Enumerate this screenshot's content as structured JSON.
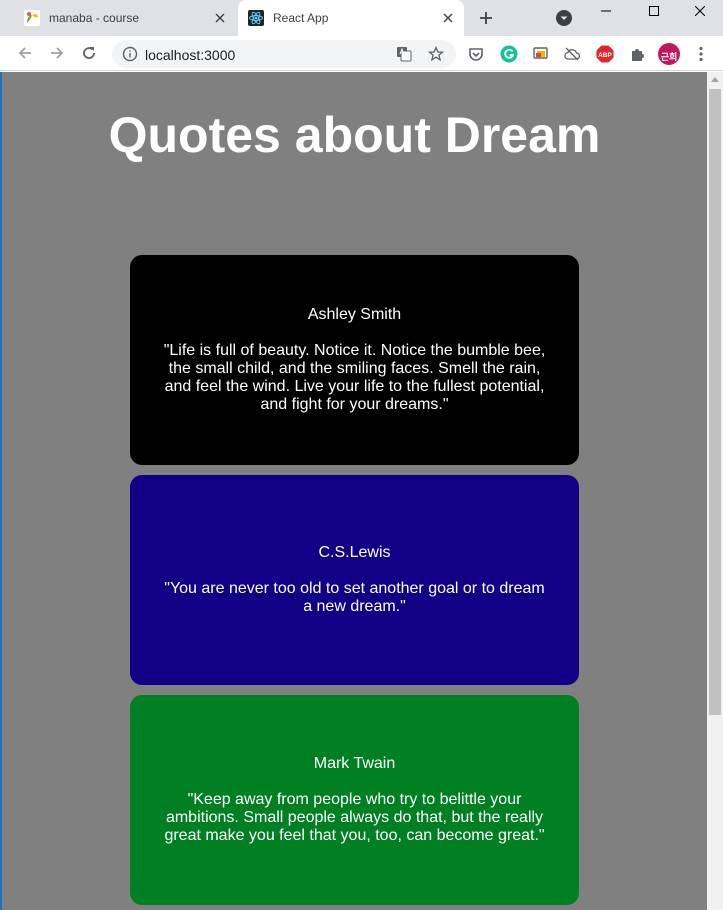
{
  "browser": {
    "tabs": [
      {
        "title": "manaba - course",
        "active": false
      },
      {
        "title": "React App",
        "active": true
      }
    ],
    "url": "localhost:3000"
  },
  "page": {
    "title": "Quotes about Dream",
    "background": "#808080",
    "quotes": [
      {
        "author": "Ashley Smith",
        "text": "\"Life is full of beauty. Notice it. Notice the bumble bee, the small child, and the smiling faces. Smell the rain, and feel the wind. Live your life to the fullest potential, and fight for your dreams.\"",
        "color": "#000000"
      },
      {
        "author": "C.S.Lewis",
        "text": "\"You are never too old to set another goal or to dream a new dream.\"",
        "color": "#110085"
      },
      {
        "author": "Mark Twain",
        "text": "\"Keep away from people who try to belittle your ambitions. Small people always do that, but the really great make you feel that you, too, can become great.\"",
        "color": "#008022"
      }
    ]
  },
  "extensions": {
    "profile_label": "근희"
  }
}
